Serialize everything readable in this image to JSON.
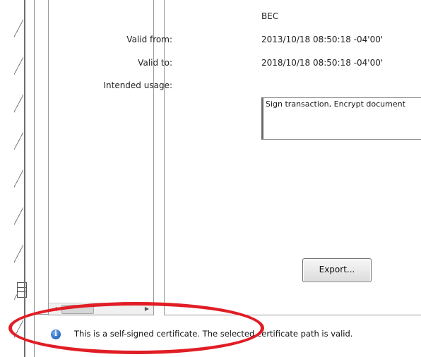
{
  "details": {
    "issuer_value": "BEC",
    "valid_from_label": "Valid from:",
    "valid_from_value": "2013/10/18 08:50:18 -04'00'",
    "valid_to_label": "Valid to:",
    "valid_to_value": "2018/10/18 08:50:18 -04'00'",
    "intended_usage_label": "Intended usage:",
    "intended_usage_value": "Sign transaction, Encrypt document"
  },
  "buttons": {
    "export_label": "Export..."
  },
  "status": {
    "icon": "info-icon",
    "text": "This is a self-signed certificate. The selected certificate path is valid."
  },
  "colors": {
    "annotation": "#e11d25",
    "info_icon": "#2f6fc7"
  }
}
